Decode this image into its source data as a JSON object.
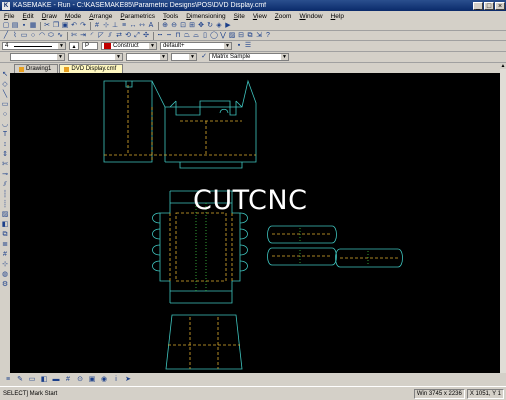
{
  "window": {
    "title": "KASEMAKE - Run - C:\\KASEMAKE85\\Parametric Designs\\POS\\DVD Display.cmf"
  },
  "menu": [
    "File",
    "Edit",
    "Draw",
    "Mode",
    "Arrange",
    "Parametrics",
    "Tools",
    "Dimensioning",
    "Site",
    "View",
    "Zoom",
    "Window",
    "Help"
  ],
  "properties": {
    "pen_value": "4",
    "pen_number": "P",
    "layer": "Construct",
    "layer_color": "#c00000",
    "style": "default+"
  },
  "dimbar": {
    "sample": "Matrix Sample"
  },
  "tabs": [
    {
      "label": "Drawing1",
      "active": false
    },
    {
      "label": "DVD Display.cmf",
      "active": true
    }
  ],
  "watermark": "CUTCNC",
  "status": {
    "left": "SELECT] Mark Start",
    "window": "Win 3745 x 2236",
    "coords": "X 1051, Y 1"
  },
  "colors": {
    "cut_line": "#3fc6c0",
    "crease_line": "#e0b030",
    "perforation": "#3fc640"
  }
}
